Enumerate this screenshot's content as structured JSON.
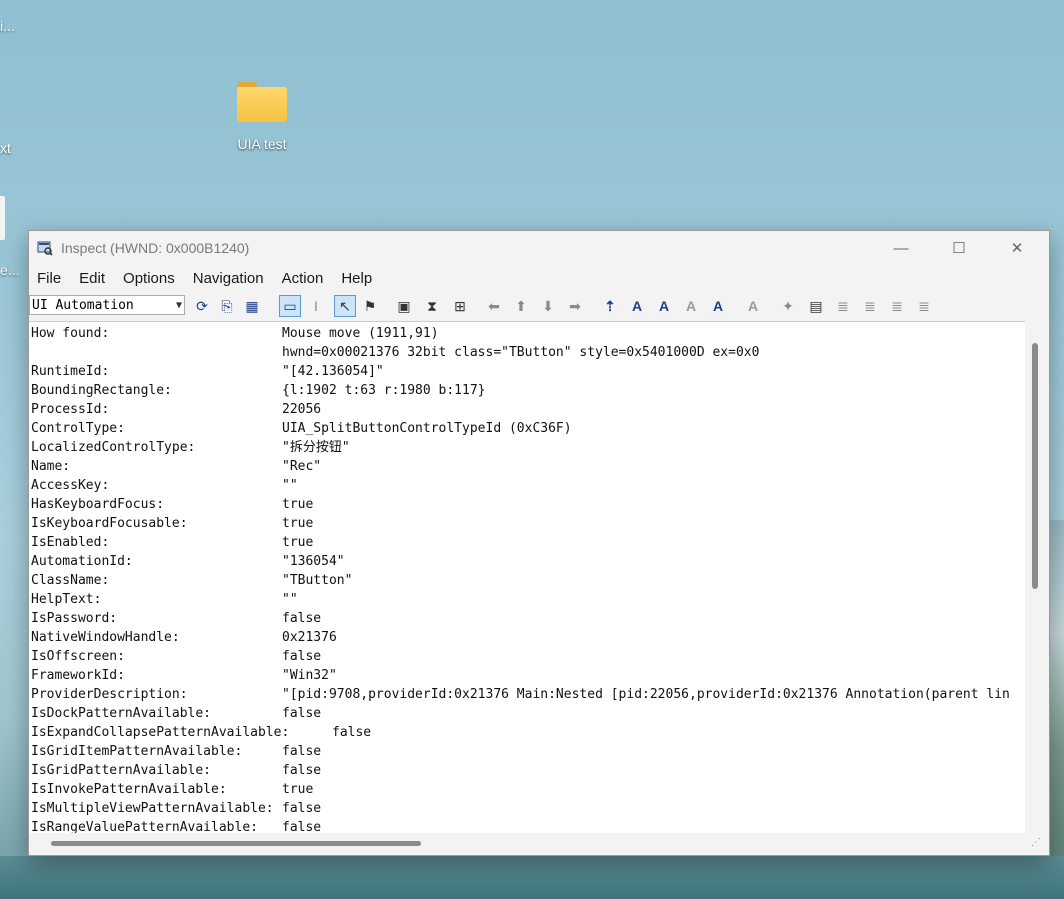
{
  "desktop": {
    "folder_label": "UIA test",
    "fragments": [
      "i...",
      "xt",
      "e..."
    ]
  },
  "window": {
    "title": "Inspect  (HWND: 0x000B1240)",
    "controls": {
      "minimize": "—",
      "maximize": "☐",
      "close": "✕"
    }
  },
  "menu": [
    "File",
    "Edit",
    "Options",
    "Navigation",
    "Action",
    "Help"
  ],
  "toolbar": {
    "mode": "UI Automation",
    "buttons": [
      {
        "name": "watch-focus",
        "glyph": "⟳"
      },
      {
        "name": "watch-caret",
        "glyph": "⎘"
      },
      {
        "name": "watch-tooltip",
        "glyph": "▦"
      },
      {
        "name": "show-highlight-rectangle",
        "glyph": "▭",
        "pressed": true
      },
      {
        "name": "show-caret-highlight",
        "glyph": "I"
      },
      {
        "name": "watch-cursor",
        "glyph": "↖",
        "pressed": true
      },
      {
        "name": "watch-tooltip-cursor",
        "glyph": "⚑"
      },
      {
        "name": "select-window",
        "glyph": "▣"
      },
      {
        "name": "hourglass",
        "glyph": "⧗"
      },
      {
        "name": "show-text",
        "glyph": "⊞"
      },
      {
        "name": "nav-back",
        "glyph": "⬅"
      },
      {
        "name": "nav-up",
        "glyph": "⬆"
      },
      {
        "name": "nav-down",
        "glyph": "⬇"
      },
      {
        "name": "nav-forward",
        "glyph": "➡"
      },
      {
        "name": "tree-parent",
        "glyph": "⇡"
      },
      {
        "name": "tree-first-child",
        "glyph": "A"
      },
      {
        "name": "tree-next-sibling",
        "glyph": "A"
      },
      {
        "name": "tree-prev-sibling",
        "glyph": "A"
      },
      {
        "name": "tree-last-child",
        "glyph": "A"
      },
      {
        "name": "tree-root",
        "glyph": "A"
      },
      {
        "name": "action-invoke",
        "glyph": "✦"
      },
      {
        "name": "action-select",
        "glyph": "▤"
      },
      {
        "name": "action-list-1",
        "glyph": "≣"
      },
      {
        "name": "action-list-2",
        "glyph": "≣"
      },
      {
        "name": "action-list-3",
        "glyph": "≣"
      },
      {
        "name": "action-list-4",
        "glyph": "≣"
      }
    ]
  },
  "properties": [
    {
      "key": "How found:",
      "value": "Mouse move (1911,91)"
    },
    {
      "key": "",
      "value": "hwnd=0x00021376 32bit class=\"TButton\" style=0x5401000D ex=0x0"
    },
    {
      "key": "RuntimeId:",
      "value": "\"[42.136054]\""
    },
    {
      "key": "BoundingRectangle:",
      "value": "{l:1902 t:63 r:1980 b:117}"
    },
    {
      "key": "ProcessId:",
      "value": "22056"
    },
    {
      "key": "ControlType:",
      "value": "UIA_SplitButtonControlTypeId (0xC36F)"
    },
    {
      "key": "LocalizedControlType:",
      "value": "\"拆分按钮\""
    },
    {
      "key": "Name:",
      "value": "\"Rec\""
    },
    {
      "key": "AccessKey:",
      "value": "\"\""
    },
    {
      "key": "HasKeyboardFocus:",
      "value": "true"
    },
    {
      "key": "IsKeyboardFocusable:",
      "value": "true"
    },
    {
      "key": "IsEnabled:",
      "value": "true"
    },
    {
      "key": "AutomationId:",
      "value": "\"136054\""
    },
    {
      "key": "ClassName:",
      "value": "\"TButton\""
    },
    {
      "key": "HelpText:",
      "value": "\"\""
    },
    {
      "key": "IsPassword:",
      "value": "false"
    },
    {
      "key": "NativeWindowHandle:",
      "value": "0x21376"
    },
    {
      "key": "IsOffscreen:",
      "value": "false"
    },
    {
      "key": "FrameworkId:",
      "value": "\"Win32\""
    },
    {
      "key": "ProviderDescription:",
      "value": "\"[pid:9708,providerId:0x21376 Main:Nested [pid:22056,providerId:0x21376 Annotation(parent lin"
    },
    {
      "key": "IsDockPatternAvailable:",
      "value": "false"
    },
    {
      "key": "IsExpandCollapsePatternAvailable:",
      "value": "false"
    },
    {
      "key": "IsGridItemPatternAvailable:",
      "value": "false"
    },
    {
      "key": "IsGridPatternAvailable:",
      "value": "false"
    },
    {
      "key": "IsInvokePatternAvailable:",
      "value": "true"
    },
    {
      "key": "IsMultipleViewPatternAvailable:",
      "value": "false"
    },
    {
      "key": "IsRangeValuePatternAvailable:",
      "value": "false"
    }
  ]
}
